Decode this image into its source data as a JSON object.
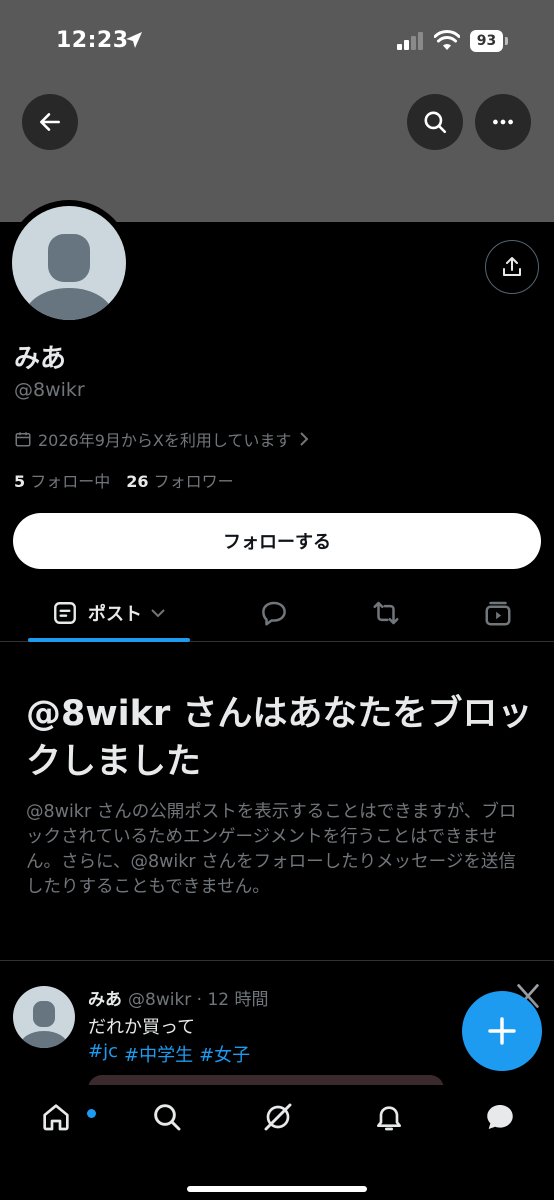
{
  "status_bar": {
    "time": "12:23",
    "battery": "93"
  },
  "profile": {
    "display_name": "みあ",
    "handle": "@8wikr",
    "joined": "2026年9月からXを利用しています",
    "following_count": "5",
    "following_label": "フォロー中",
    "followers_count": "26",
    "followers_label": "フォロワー",
    "follow_button": "フォローする"
  },
  "tabs": {
    "posts_label": "ポスト",
    "active": "posts"
  },
  "blocked": {
    "title": "@8wikr さんはあなたをブロックしました",
    "description": "@8wikr さんの公開ポストを表示することはできますが、ブロックされているためエンゲージメントを行うことはできません。さらに、@8wikr さんをフォローしたりメッセージを送信したりすることもできません。"
  },
  "post": {
    "name": "みあ",
    "meta": "@8wikr · 12 時間",
    "text": "だれか買って",
    "tags": [
      "#jc",
      "#中学生",
      "#女子"
    ]
  },
  "colors": {
    "accent": "#1d9bf0",
    "background": "#000000",
    "banner": "#595959",
    "muted": "#71767b"
  },
  "icons": {
    "header": [
      "back-arrow-icon",
      "search-icon",
      "more-icon"
    ],
    "tabs": [
      "posts-icon",
      "chevron-down-icon",
      "reply-icon",
      "repost-icon",
      "media-icon"
    ],
    "nav": [
      "home-icon",
      "search-icon",
      "grok-icon",
      "notifications-icon",
      "messages-icon"
    ]
  }
}
